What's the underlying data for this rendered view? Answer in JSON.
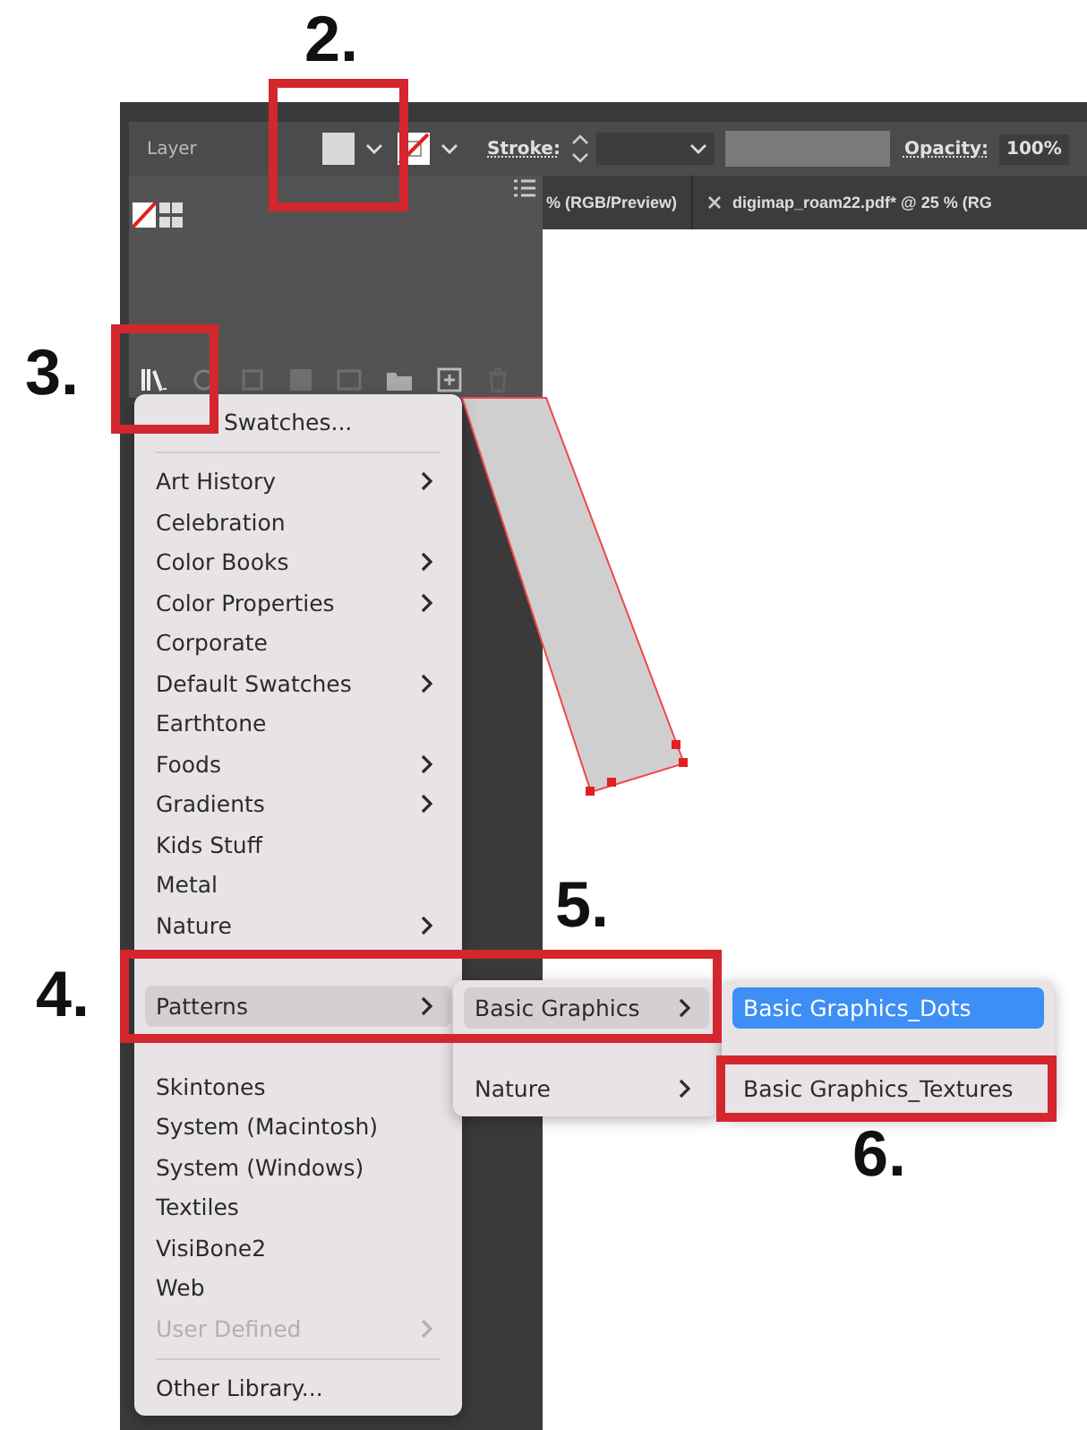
{
  "toolbar": {
    "object_type": "Layer",
    "stroke_label": "Stroke:",
    "opacity_label": "Opacity:",
    "opacity_value": "100%"
  },
  "document_tabs": [
    {
      "title": "% (RGB/Preview)",
      "closable": false
    },
    {
      "title": "digimap_roam22.pdf* @ 25 % (RG",
      "closable": true
    }
  ],
  "swatch_library_menu": {
    "items": [
      {
        "kind": "item_start_covered",
        "label": "Swatches...",
        "submenu": false,
        "selected": false,
        "disabled": false
      },
      {
        "kind": "separator"
      },
      {
        "kind": "item",
        "label": "Art History",
        "submenu": true,
        "selected": false,
        "disabled": false
      },
      {
        "kind": "item",
        "label": "Celebration",
        "submenu": false,
        "selected": false,
        "disabled": false
      },
      {
        "kind": "item",
        "label": "Color Books",
        "submenu": true,
        "selected": false,
        "disabled": false
      },
      {
        "kind": "item",
        "label": "Color Properties",
        "submenu": true,
        "selected": false,
        "disabled": false
      },
      {
        "kind": "item",
        "label": "Corporate",
        "submenu": false,
        "selected": false,
        "disabled": false
      },
      {
        "kind": "item",
        "label": "Default Swatches",
        "submenu": true,
        "selected": false,
        "disabled": false
      },
      {
        "kind": "item",
        "label": "Earthtone",
        "submenu": false,
        "selected": false,
        "disabled": false
      },
      {
        "kind": "item",
        "label": "Foods",
        "submenu": true,
        "selected": false,
        "disabled": false
      },
      {
        "kind": "item",
        "label": "Gradients",
        "submenu": true,
        "selected": false,
        "disabled": false
      },
      {
        "kind": "item",
        "label": "Kids Stuff",
        "submenu": false,
        "selected": false,
        "disabled": false
      },
      {
        "kind": "item",
        "label": "Metal",
        "submenu": false,
        "selected": false,
        "disabled": false
      },
      {
        "kind": "item",
        "label": "Nature",
        "submenu": true,
        "selected": false,
        "disabled": false
      },
      {
        "kind": "covered"
      },
      {
        "kind": "item",
        "label": "Patterns",
        "submenu": true,
        "selected": true,
        "disabled": false
      },
      {
        "kind": "covered"
      },
      {
        "kind": "item",
        "label": "Skintones",
        "submenu": false,
        "selected": false,
        "disabled": false
      },
      {
        "kind": "item",
        "label": "System (Macintosh)",
        "submenu": false,
        "selected": false,
        "disabled": false
      },
      {
        "kind": "item",
        "label": "System (Windows)",
        "submenu": false,
        "selected": false,
        "disabled": false
      },
      {
        "kind": "item",
        "label": "Textiles",
        "submenu": false,
        "selected": false,
        "disabled": false
      },
      {
        "kind": "item",
        "label": "VisiBone2",
        "submenu": false,
        "selected": false,
        "disabled": false
      },
      {
        "kind": "item",
        "label": "Web",
        "submenu": false,
        "selected": false,
        "disabled": false
      },
      {
        "kind": "item",
        "label": "User Defined",
        "submenu": true,
        "selected": false,
        "disabled": true
      },
      {
        "kind": "separator"
      },
      {
        "kind": "item",
        "label": "Other Library...",
        "submenu": false,
        "selected": false,
        "disabled": false
      }
    ]
  },
  "patterns_submenu": {
    "items": [
      {
        "kind": "item",
        "label": "Basic Graphics",
        "submenu": true,
        "selected": true,
        "disabled": false
      },
      {
        "kind": "covered"
      },
      {
        "kind": "item",
        "label": "Nature",
        "submenu": true,
        "selected": false,
        "disabled": false
      }
    ]
  },
  "basic_graphics_submenu": {
    "items": [
      {
        "kind": "item",
        "label": "Basic Graphics_Dots",
        "submenu": false,
        "selected": true,
        "disabled": false
      },
      {
        "kind": "covered"
      },
      {
        "kind": "item",
        "label": "Basic Graphics_Textures",
        "submenu": false,
        "selected": false,
        "disabled": false
      }
    ]
  },
  "annotations": [
    {
      "label": "2."
    },
    {
      "label": "3."
    },
    {
      "label": "4."
    },
    {
      "label": "5."
    },
    {
      "label": "6."
    }
  ]
}
